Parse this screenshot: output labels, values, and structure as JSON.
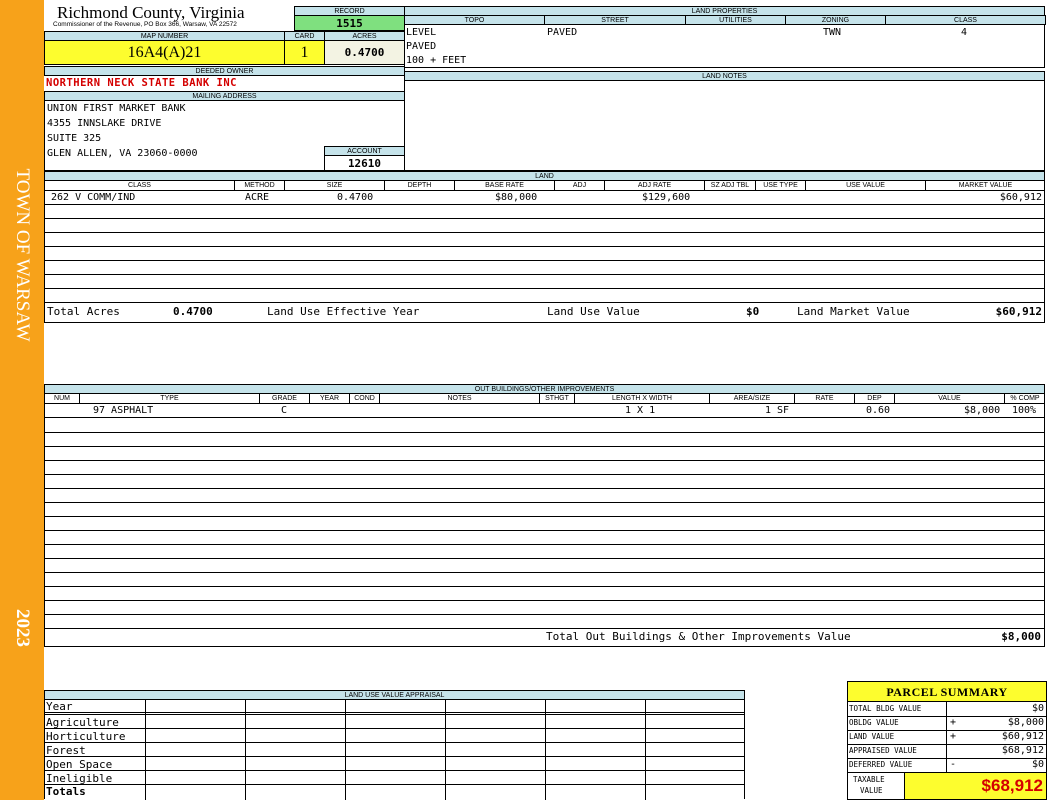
{
  "colors": {
    "sidebar": "#f7a21a",
    "header_bg": "#c5e3ea",
    "highlight_yellow": "#fdfd2e",
    "record_green": "#7fe07f",
    "owner_red": "#d40000"
  },
  "sidebar": {
    "town": "TOWN OF WARSAW",
    "year": "2023"
  },
  "header": {
    "county": "Richmond County, Virginia",
    "commissioner": "Commissioner of the Revenue, PO Box 366, Warsaw, VA 22572",
    "record_label": "RECORD",
    "record": "1515",
    "map_number_label": "MAP NUMBER",
    "map_number": "16A4(A)21",
    "card_label": "CARD",
    "card": "1",
    "acres_label": "ACRES",
    "acres": "0.4700"
  },
  "land_properties": {
    "title": "LAND PROPERTIES",
    "columns": [
      "TOPO",
      "STREET",
      "UTILITIES",
      "ZONING",
      "CLASS"
    ],
    "topo": [
      "LEVEL",
      "PAVED",
      "100 + FEET"
    ],
    "street": "PAVED",
    "utilities": "",
    "zoning": "TWN",
    "class": "4"
  },
  "owner": {
    "deeded_owner_label": "DEEDED OWNER",
    "deeded_owner": "NORTHERN NECK STATE BANK INC",
    "mailing_label": "MAILING ADDRESS",
    "mailing": [
      "UNION FIRST MARKET BANK",
      "4355 INNSLAKE DRIVE",
      "SUITE 325",
      "GLEN ALLEN, VA 23060-0000"
    ],
    "account_label": "ACCOUNT",
    "account": "12610"
  },
  "land_notes": {
    "title": "LAND NOTES"
  },
  "land": {
    "title": "LAND",
    "columns": [
      "CLASS",
      "METHOD",
      "SIZE",
      "DEPTH",
      "BASE RATE",
      "ADJ",
      "ADJ RATE",
      "SZ ADJ TBL",
      "USE TYPE",
      "USE VALUE",
      "MARKET VALUE"
    ],
    "row": {
      "class": "262 V COMM/IND",
      "method": "ACRE",
      "size": "0.4700",
      "base_rate": "$80,000",
      "adj_rate": "$129,600",
      "market_value": "$60,912"
    },
    "total_acres_label": "Total Acres",
    "total_acres": "0.4700",
    "effective_year_label": "Land Use Effective Year",
    "use_value_label": "Land Use Value",
    "use_value": "$0",
    "market_value_label": "Land Market Value",
    "market_value": "$60,912"
  },
  "outbuildings": {
    "title": "OUT BUILDINGS/OTHER IMPROVEMENTS",
    "columns": [
      "NUM",
      "TYPE",
      "GRADE",
      "YEAR",
      "COND",
      "NOTES",
      "STHGT",
      "LENGTH X WIDTH",
      "AREA/SIZE",
      "RATE",
      "DEP",
      "VALUE",
      "% COMP"
    ],
    "row": {
      "type": "97 ASPHALT",
      "grade": "C",
      "lxw": "1 X 1",
      "area": "1 SF",
      "dep": "0.60",
      "value": "$8,000",
      "comp": "100%"
    },
    "total_label": "Total Out Buildings & Other Improvements Value",
    "total": "$8,000"
  },
  "land_use_appraisal": {
    "title": "LAND USE VALUE APPRAISAL",
    "rows": [
      "Year",
      "Agriculture",
      "Horticulture",
      "Forest",
      "Open Space",
      "Ineligible",
      "Totals"
    ]
  },
  "parcel_summary": {
    "title": "PARCEL SUMMARY",
    "bldg_label": "TOTAL BLDG VALUE",
    "bldg": "$0",
    "obldg_label": "OBLDG VALUE",
    "obldg_sign": "+",
    "obldg": "$8,000",
    "land_label": "LAND VALUE",
    "land_sign": "+",
    "land": "$60,912",
    "appraised_label": "APPRAISED VALUE",
    "appraised": "$68,912",
    "deferred_label": "DEFERRED VALUE",
    "deferred_sign": "-",
    "deferred": "$0",
    "taxable_label_1": "TAXABLE",
    "taxable_label_2": "VALUE",
    "taxable": "$68,912"
  }
}
